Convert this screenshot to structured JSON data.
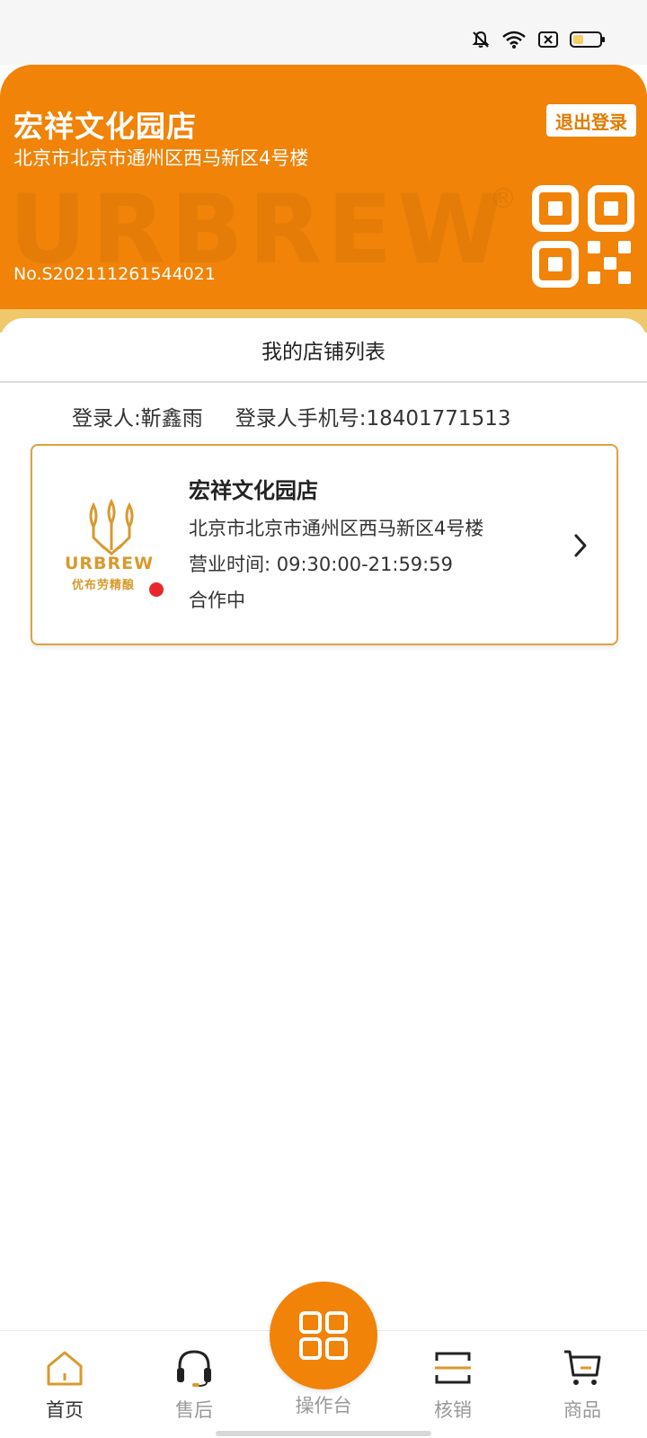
{
  "header": {
    "shop_name": "宏祥文化园店",
    "address": "北京市北京市通州区西马新区4号楼",
    "watermark": "URBREW",
    "watermark_mark": "®",
    "store_no": "No.S202111261544021",
    "logout_label": "退出登录"
  },
  "list": {
    "title": "我的店铺列表",
    "login_user_label": "登录人:",
    "login_user_name": "靳鑫雨",
    "login_phone_label": "登录人手机号:",
    "login_phone": "18401771513"
  },
  "store_card": {
    "logo_text_en": "URBREW",
    "logo_text_cn": "优布劳精酿",
    "name": "宏祥文化园店",
    "address": "北京市北京市通州区西马新区4号楼",
    "hours": "营业时间: 09:30:00-21:59:59",
    "status": "合作中"
  },
  "tabs": [
    {
      "label": "首页",
      "icon": "home-icon",
      "active": true
    },
    {
      "label": "售后",
      "icon": "headset-icon",
      "active": false
    },
    {
      "label": "操作台",
      "icon": "grid-icon",
      "active": false
    },
    {
      "label": "核销",
      "icon": "scan-icon",
      "active": false
    },
    {
      "label": "商品",
      "icon": "cart-icon",
      "active": false
    }
  ],
  "colors": {
    "brand_orange": "#f08308",
    "brand_gold": "#d9992e",
    "status_red": "#e8272d"
  }
}
